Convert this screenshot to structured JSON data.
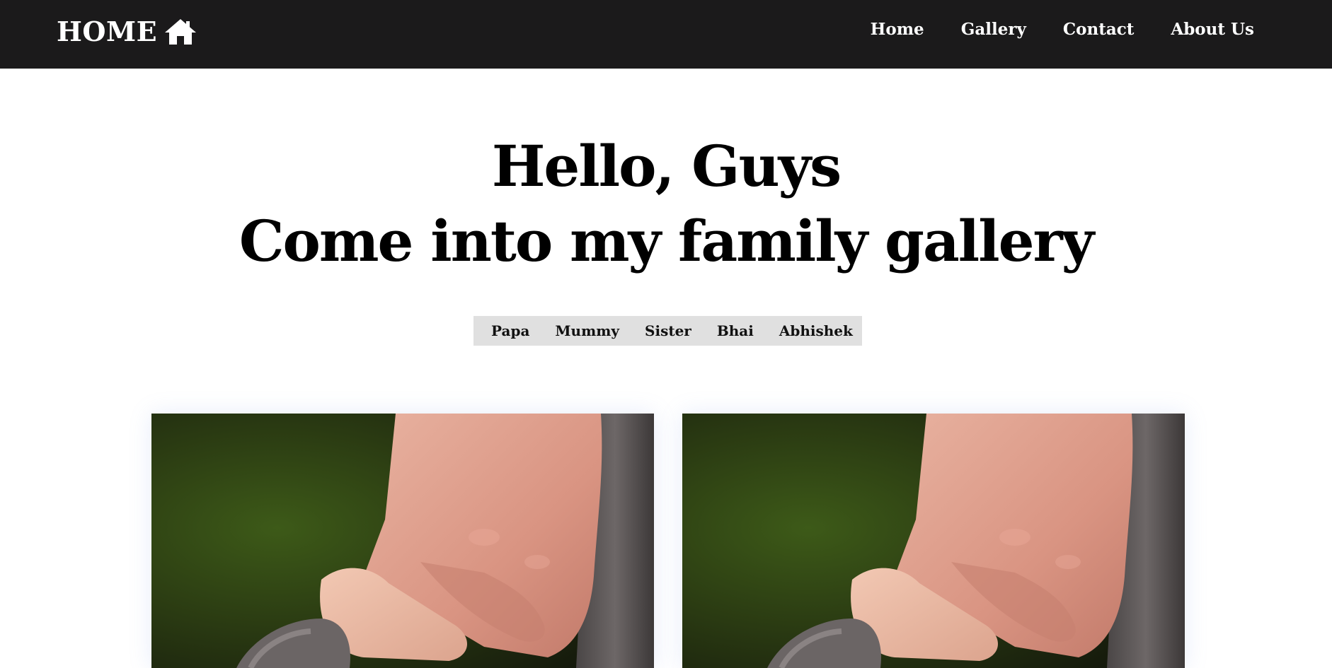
{
  "navbar": {
    "brand": "HOME",
    "brand_icon": "house-icon",
    "links": [
      "Home",
      "Gallery",
      "Contact",
      "About Us"
    ]
  },
  "hero": {
    "line1": "Hello, Guys",
    "line2": "Come into my family gallery"
  },
  "filters": [
    "Papa",
    "Mummy",
    "Sister",
    "Bhai",
    "Abhishek"
  ],
  "gallery": {
    "photo_subject": "adult-hand-holding-baby-hand",
    "colors": {
      "navbar_bg": "#1b1a1b",
      "filter_bg": "#e0e0e0",
      "text": "#000000"
    }
  }
}
